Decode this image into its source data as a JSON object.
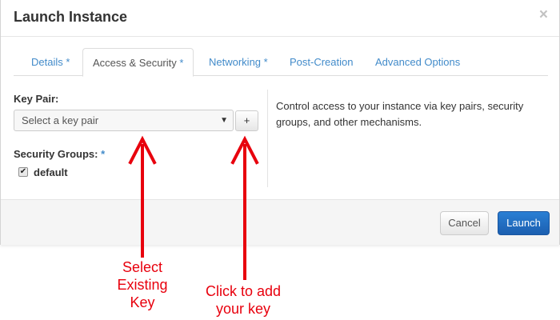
{
  "dialog": {
    "title": "Launch Instance",
    "close_symbol": "×"
  },
  "tabs": [
    {
      "label": "Details",
      "required_mark": "*",
      "active": false
    },
    {
      "label": "Access & Security",
      "required_mark": "*",
      "active": true
    },
    {
      "label": "Networking",
      "required_mark": "*",
      "active": false
    },
    {
      "label": "Post-Creation",
      "required_mark": "",
      "active": false
    },
    {
      "label": "Advanced Options",
      "required_mark": "",
      "active": false
    }
  ],
  "access_security": {
    "key_pair_label": "Key Pair:",
    "key_pair_select_value": "Select a key pair",
    "key_pair_caret": "▼",
    "add_key_button": "+",
    "security_groups_label": "Security Groups:",
    "security_groups_required": "*",
    "security_groups": [
      {
        "name": "default",
        "checked": true,
        "check_symbol": "✔"
      }
    ],
    "help_text": "Control access to your instance via key pairs, security groups, and other mechanisms."
  },
  "footer": {
    "cancel_label": "Cancel",
    "launch_label": "Launch"
  },
  "annotations": {
    "select_existing_key": [
      "Select",
      "Existing",
      "Key"
    ],
    "click_to_add_key": [
      "Click to add",
      "your key"
    ],
    "color": "#e8000d"
  },
  "colors": {
    "link": "#428bca",
    "primary_button": "#1c5fb0",
    "annotation_red": "#e8000d"
  }
}
